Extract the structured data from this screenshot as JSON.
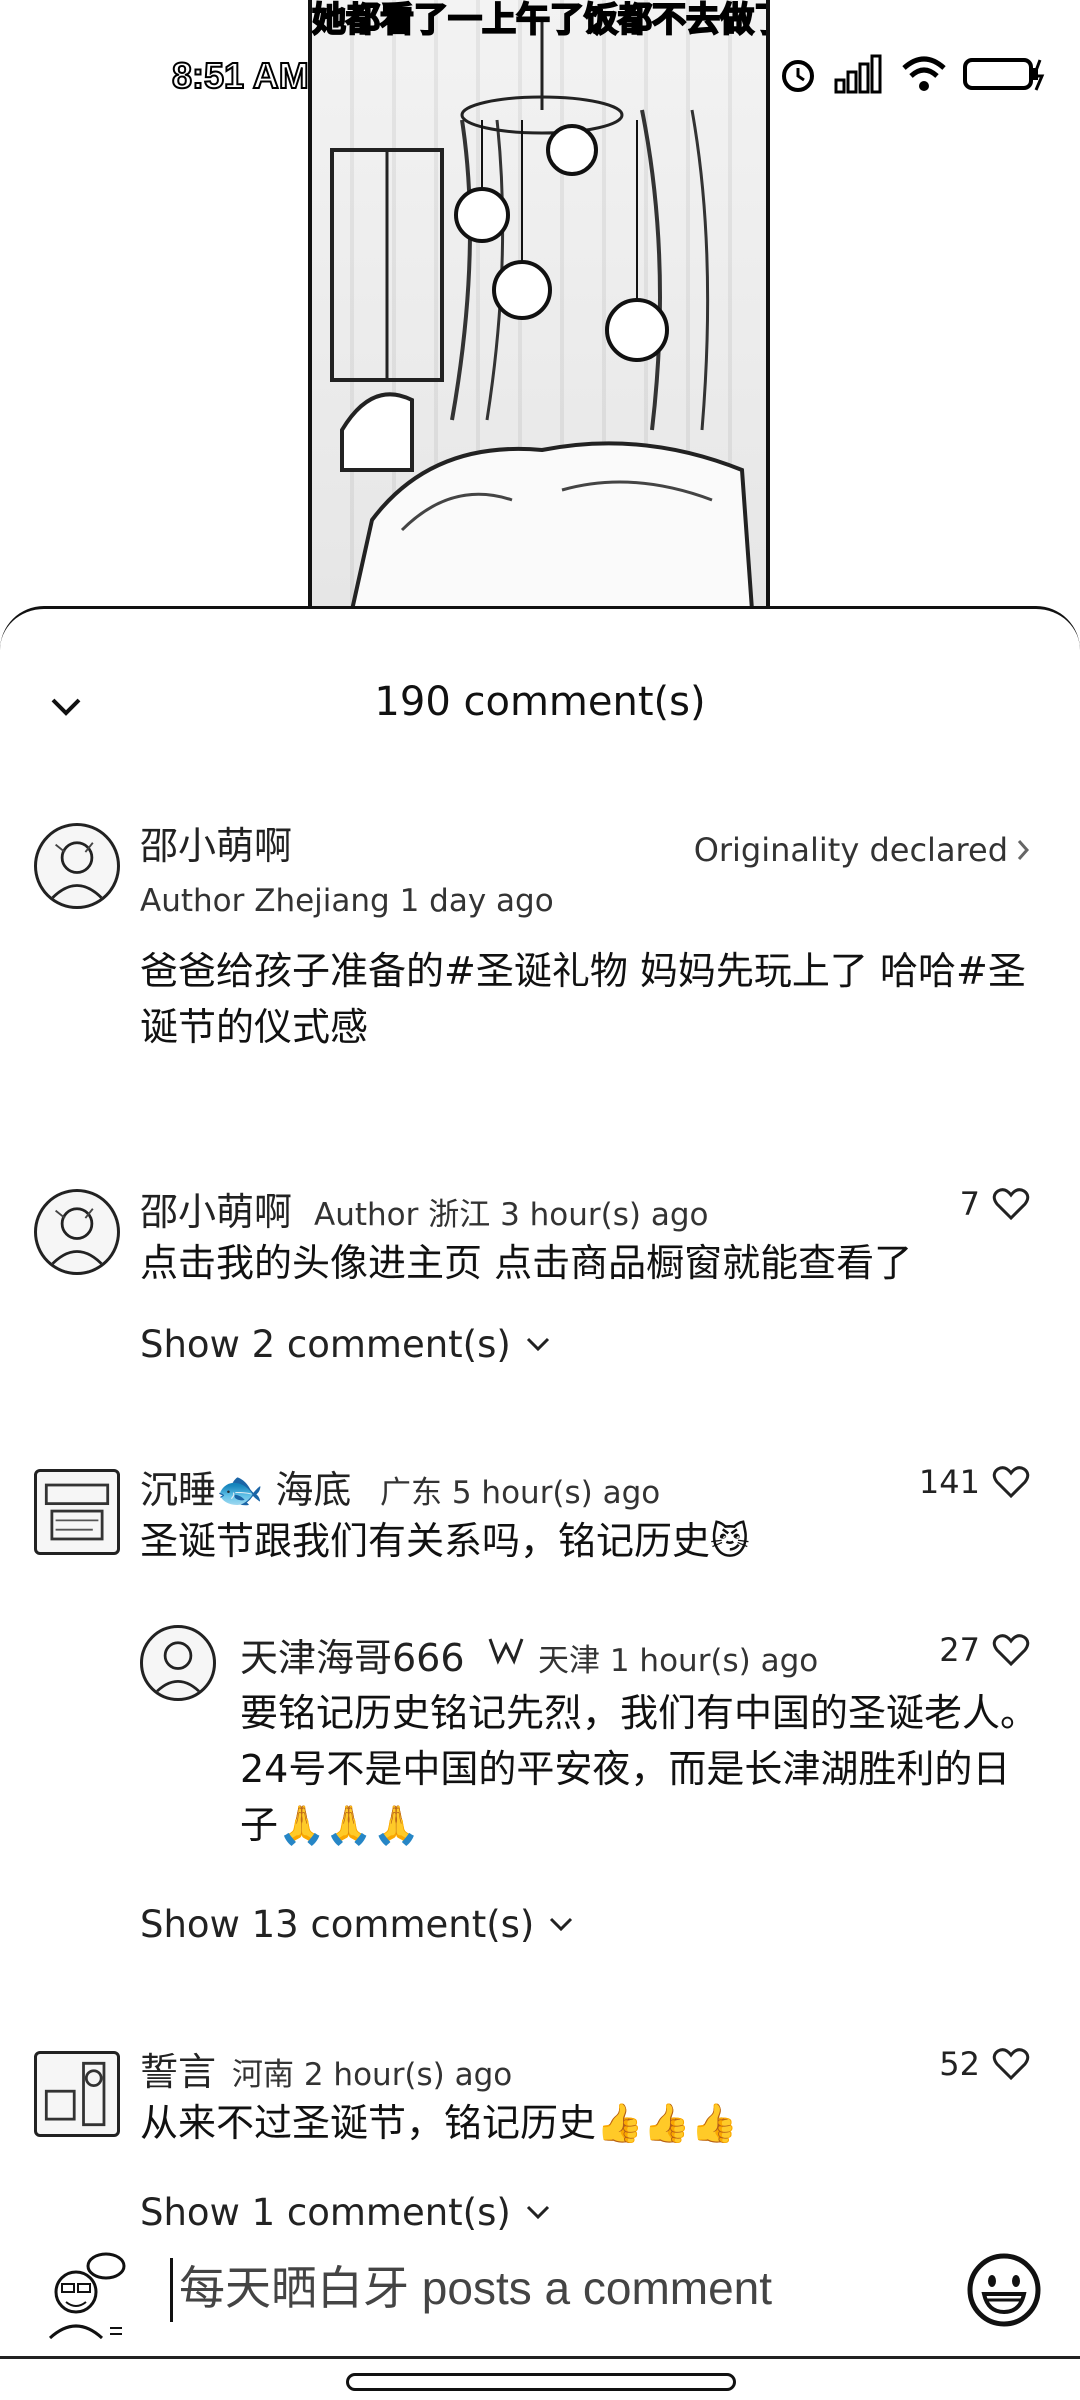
{
  "video": {
    "caption": "她都看了一上午了饭都不去做了"
  },
  "status_bar": {
    "time": "8:51 AM"
  },
  "sheet": {
    "title": "190 comment(s)"
  },
  "author_post": {
    "name": "邵小萌啊",
    "meta": "Author Zhejiang 1 day ago",
    "originality": "Originality declared",
    "text": "爸爸给孩子准备的#圣诞礼物 妈妈先玩上了 哈哈#圣诞节的仪式感"
  },
  "comments": [
    {
      "name": "邵小萌啊",
      "meta": "Author 浙江 3 hour(s) ago",
      "likes": "7",
      "text": "点击我的头像进主页 点击商品橱窗就能查看了",
      "show_more": "Show 2 comment(s)"
    },
    {
      "name": "沉睡🐟 海底",
      "meta": "广东 5 hour(s) ago",
      "likes": "141",
      "text": "圣诞节跟我们有关系吗，铭记历史😼",
      "reply": {
        "name": "天津海哥666",
        "meta": "天津 1 hour(s) ago",
        "likes": "27",
        "text": "要铭记历史铭记先烈，我们有中国的圣诞老人。24号不是中国的平安夜，而是长津湖胜利的日子🙏🙏🙏"
      },
      "show_more": "Show 13 comment(s)"
    },
    {
      "name": "誓言",
      "meta": "河南 2 hour(s) ago",
      "likes": "52",
      "text": "从来不过圣诞节，铭记历史👍👍👍",
      "show_more": "Show 1 comment(s)"
    }
  ],
  "input": {
    "placeholder": "每天晒白牙 posts a comment"
  }
}
